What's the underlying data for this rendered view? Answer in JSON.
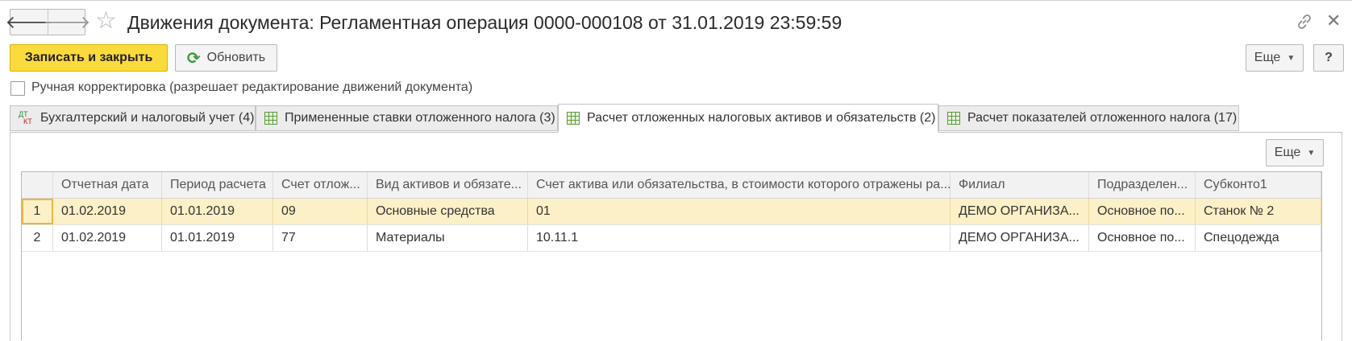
{
  "window": {
    "title": "Движения документа: Регламентная операция 0000-000108 от 31.01.2019 23:59:59"
  },
  "toolbar": {
    "save_close_label": "Записать и закрыть",
    "refresh_label": "Обновить",
    "more_label": "Еще",
    "help_label": "?"
  },
  "manual_edit": {
    "label": "Ручная корректировка (разрешает редактирование движений документа)",
    "checked": false
  },
  "tabs": [
    {
      "label": "Бухгалтерский и налоговый учет (4)",
      "icon": "dt-kt-icon",
      "active": false
    },
    {
      "label": "Примененные ставки отложенного налога (3)",
      "icon": "table-icon",
      "active": false
    },
    {
      "label": "Расчет отложенных налоговых активов и обязательств (2)",
      "icon": "table-icon",
      "active": true
    },
    {
      "label": "Расчет показателей отложенного налога (17)",
      "icon": "table-icon",
      "active": false
    }
  ],
  "grid": {
    "more_label": "Еще",
    "columns": [
      "",
      "Отчетная дата",
      "Период расчета",
      "Счет отлож...",
      "Вид активов и обязате...",
      "Счет актива или обязательства, в стоимости которого отражены ра...",
      "Филиал",
      "Подразделен...",
      "Субконто1"
    ],
    "rows": [
      [
        "1",
        "01.02.2019",
        "01.01.2019",
        "09",
        "Основные средства",
        "01",
        "ДЕМО ОРГАНИЗА...",
        "Основное по...",
        "Станок № 2"
      ],
      [
        "2",
        "01.02.2019",
        "01.01.2019",
        "77",
        "Материалы",
        "10.11.1",
        "ДЕМО ОРГАНИЗА...",
        "Основное по...",
        "Спецодежда"
      ]
    ],
    "selected_row": 1
  },
  "colors": {
    "primary_button": "#fbdb3c",
    "selected_row": "#fcf0c6",
    "tab_inactive": "#ececec"
  }
}
